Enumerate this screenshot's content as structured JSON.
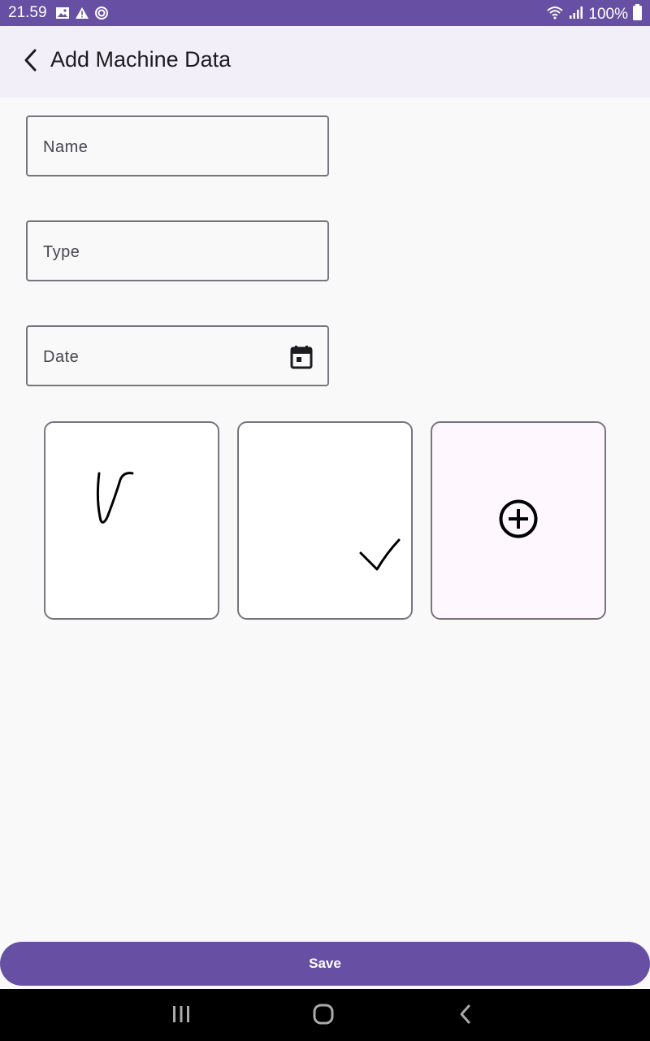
{
  "status_bar": {
    "time": "21.59",
    "battery": "100%",
    "left_icons": [
      "image-icon",
      "warning-icon",
      "sync-icon"
    ],
    "right_icons": [
      "wifi-icon",
      "signal-icon",
      "battery-icon"
    ]
  },
  "app_bar": {
    "title": "Add Machine Data",
    "back_icon": "chevron-left-icon"
  },
  "form": {
    "name_label": "Name",
    "type_label": "Type",
    "date_label": "Date",
    "date_icon": "calendar-icon"
  },
  "tiles": [
    {
      "kind": "signature-image"
    },
    {
      "kind": "signature-image"
    },
    {
      "kind": "add-button",
      "icon": "add-circle-icon"
    }
  ],
  "actions": {
    "save_label": "Save"
  },
  "nav_bar": {
    "items": [
      "recent-apps-icon",
      "home-icon",
      "back-icon"
    ]
  },
  "colors": {
    "primary": "#6750a4",
    "app_bar_bg": "#f3eff8",
    "background": "#f9f9f9",
    "outline": "#79747e"
  }
}
